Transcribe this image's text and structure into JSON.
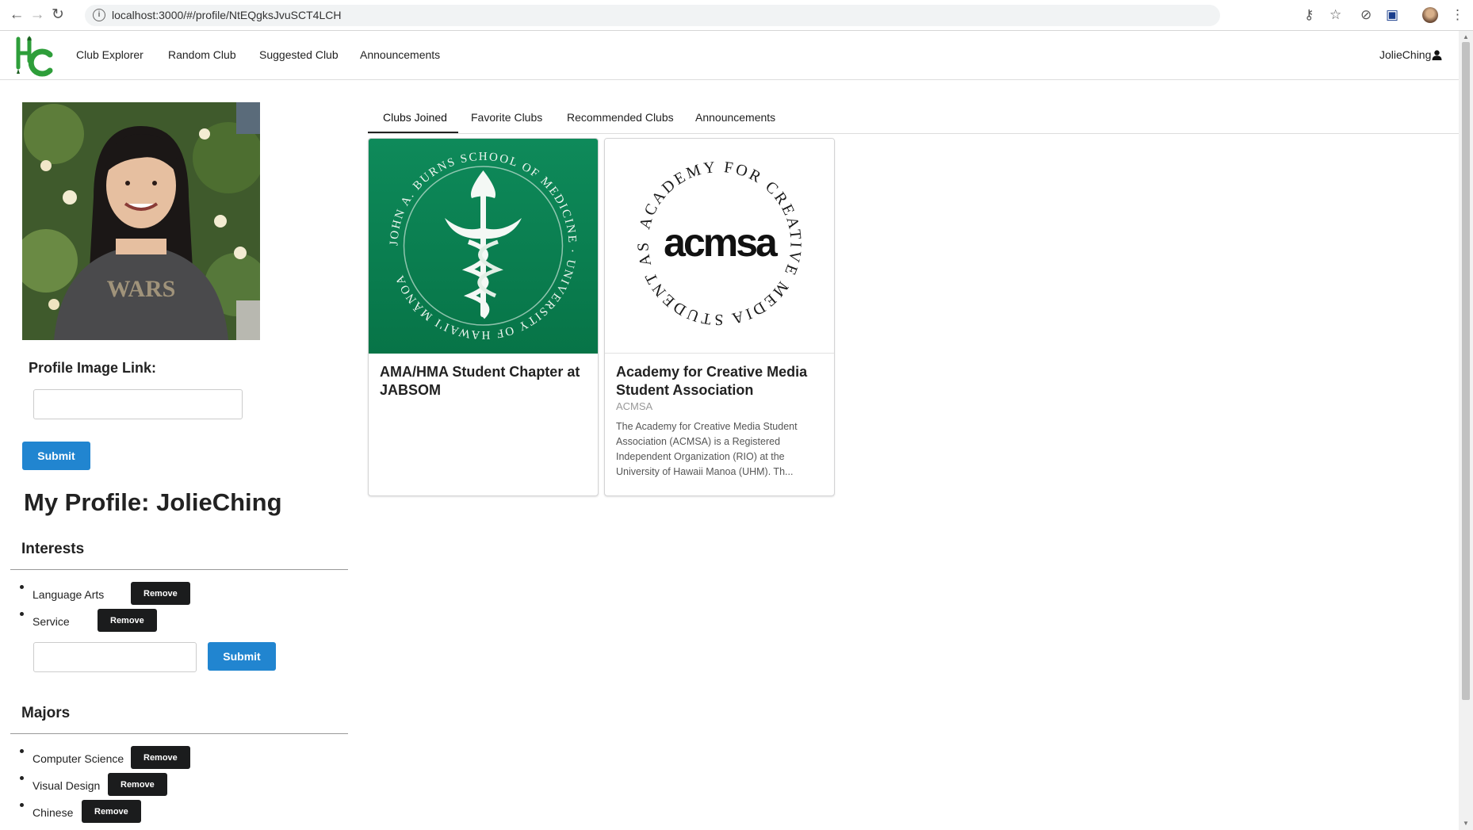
{
  "browser": {
    "url": "localhost:3000/#/profile/NtEQgksJvuSCT4LCH"
  },
  "navbar": {
    "logo_text": "HC",
    "links": [
      "Club Explorer",
      "Random Club",
      "Suggested Club",
      "Announcements"
    ],
    "user": "JolieChing"
  },
  "profile": {
    "image_link_label": "Profile Image Link:",
    "image_link_value": "",
    "submit_label": "Submit",
    "title": "My Profile: JolieChing"
  },
  "interests": {
    "header": "Interests",
    "items": [
      {
        "label": "Language Arts",
        "remove": "Remove"
      },
      {
        "label": "Service",
        "remove": "Remove"
      }
    ],
    "input_value": "",
    "submit_label": "Submit"
  },
  "majors": {
    "header": "Majors",
    "items": [
      {
        "label": "Computer Science",
        "remove": "Remove"
      },
      {
        "label": "Visual Design",
        "remove": "Remove"
      },
      {
        "label": "Chinese",
        "remove": "Remove"
      }
    ]
  },
  "tabs": {
    "items": [
      "Clubs Joined",
      "Favorite Clubs",
      "Recommended Clubs",
      "Announcements"
    ],
    "active": "Clubs Joined"
  },
  "cards": [
    {
      "title": "AMA/HMA Student Chapter at JABSOM",
      "meta": "",
      "description": "",
      "logo_text": "JOHN A. BURNS SCHOOL OF MEDICINE · UNIVERSITY OF HAWAI'I MĀNOA"
    },
    {
      "title": "Academy for Creative Media Student Association",
      "meta": "ACMSA",
      "description": "The Academy for Creative Media Student Association (ACMSA) is a Registered Independent Organization (RIO) at the University of Hawaii Manoa (UHM). Th...",
      "logo_text": "acmsa",
      "logo_ring_text": "ACADEMY FOR CREATIVE MEDIA STUDENT ASSOCIATION"
    }
  ],
  "colors": {
    "primary_button": "#2185d0",
    "remove_button": "#1b1c1d",
    "logo_green": "#2e9e3a",
    "jabsom_green": "#0b7a4e"
  }
}
